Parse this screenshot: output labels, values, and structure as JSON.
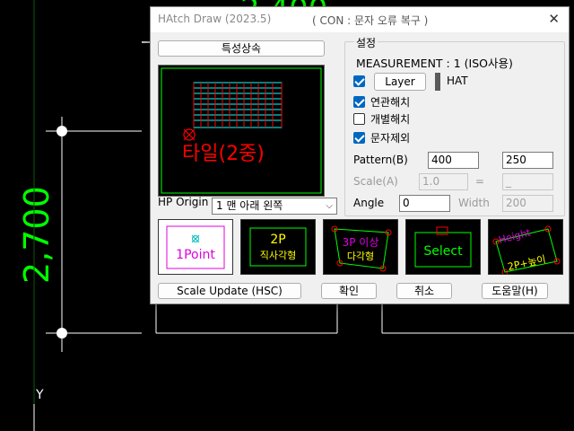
{
  "cad": {
    "dimension_text": "2,700",
    "axis_label": "Y"
  },
  "dialog": {
    "title": "HAtch Draw (2023.5)",
    "subtitle": "( CON : 문자 오류 복구 )",
    "close_glyph": "✕",
    "inherit_button": "특성상속",
    "preview_text": "타일(2중)",
    "hp_origin_label": "HP Origin",
    "hp_origin_value": "1 맨 아래 왼쪽",
    "settings": {
      "legend": "설정",
      "measurement": "MEASUREMENT : 1 (ISO사용)",
      "layer_button": "Layer",
      "layer_value": "HAT",
      "associative": "연관해치",
      "individual": "개별해치",
      "text_exclude": "문자제외",
      "pattern_label": "Pattern(B)",
      "pattern_value1": "400",
      "pattern_value2": "250",
      "scale_label": "Scale(A)",
      "scale_value": "1.0",
      "scale_equals": "=",
      "scale_result": "_",
      "angle_label": "Angle",
      "angle_value": "0",
      "width_label": "Width",
      "width_value": "200"
    },
    "tiles": {
      "one_point": "1Point",
      "two_p_title": "2P",
      "two_p_sub": "직사각형",
      "three_p_title": "3P 이상",
      "three_p_sub": "다각형",
      "select": "Select",
      "height_label": "Height",
      "height_sub": "2P+높이"
    },
    "buttons": {
      "scale_update": "Scale Update (HSC)",
      "ok": "확인",
      "cancel": "취소",
      "help": "도움말(H)"
    }
  },
  "colors": {
    "cad_green": "#00ff00",
    "hatch_red": "#ff0000",
    "hatch_cyan": "#00ffff",
    "magenta": "#e000e0",
    "yellow": "#ffff00",
    "accent_blue": "#0067c0"
  }
}
